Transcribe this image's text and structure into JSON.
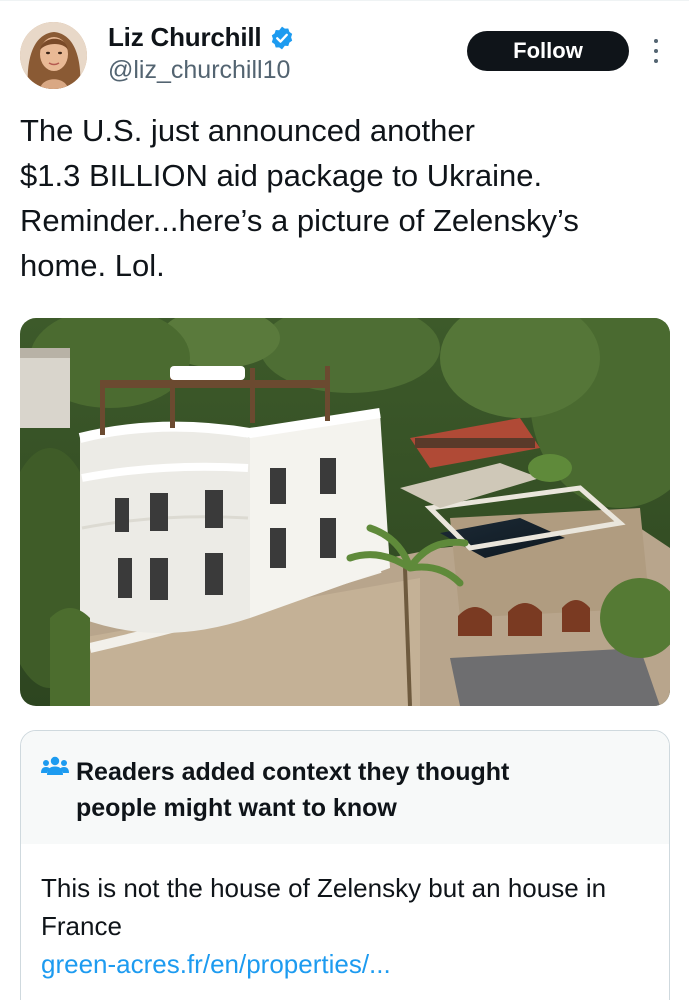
{
  "author": {
    "display_name": "Liz Churchill",
    "handle": "@liz_churchill10",
    "verified": true
  },
  "actions": {
    "follow_label": "Follow"
  },
  "tweet": {
    "text": "The U.S. just announced another\n$1.3 BILLION aid package to Ukraine.\nReminder...here’s a picture of Zelensky’s\nhome. Lol."
  },
  "media": {
    "type": "photo",
    "subject": "white villa with terraces and pool on a hillside"
  },
  "community_note": {
    "title": "Readers added context they thought people might want to know",
    "body": "This is not the house of Zelensky but an house in France",
    "link_text": "green-acres.fr/en/properties/..."
  },
  "colors": {
    "text": "#0f1419",
    "secondary": "#536471",
    "link": "#1d9bf0",
    "verified": "#1d9bf0",
    "button_bg": "#0f1419",
    "note_head_bg": "#f7f9f9",
    "border": "#cfd9de"
  },
  "icons": {
    "verified": "verified-badge-icon",
    "more": "more-vertical-icon",
    "note": "people-group-icon"
  }
}
